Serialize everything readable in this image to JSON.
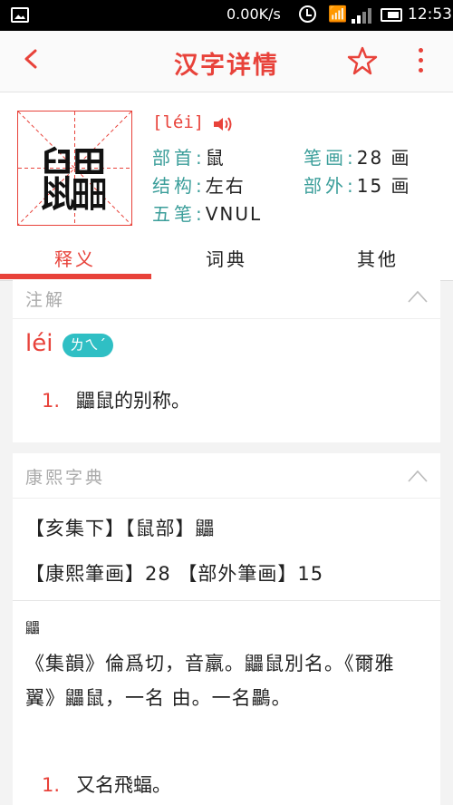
{
  "status_bar": {
    "speed": "0.00K/s",
    "time": "12:53"
  },
  "app_bar": {
    "title": "汉字详情"
  },
  "character": {
    "glyph": "鼺",
    "pinyin_bracket": "[léi]",
    "rows": [
      {
        "key": "部首:",
        "value": "鼠"
      },
      {
        "key": "笔画:",
        "value": "28 画"
      },
      {
        "key": "结构:",
        "value": "左右"
      },
      {
        "key": "部外:",
        "value": "15 画"
      },
      {
        "key": "五笔:",
        "value": "VNUL"
      }
    ]
  },
  "tabs": [
    {
      "label": "释义",
      "active": true
    },
    {
      "label": "词典",
      "active": false
    },
    {
      "label": "其他",
      "active": false
    }
  ],
  "annotation": {
    "title": "注解",
    "pinyin": "léi",
    "zhuyin": "ㄌㄟˊ",
    "definitions": [
      {
        "num": "1.",
        "text": "鼺鼠的别称。"
      }
    ]
  },
  "kangxi": {
    "title": "康熙字典",
    "line1": "【亥集下】【鼠部】鼺",
    "line2": "【康熙筆画】28 【部外筆画】15",
    "small_glyph": "鼺",
    "paragraph": "《集韻》倫爲切，音羸。鼺鼠別名。《爾雅翼》鼺鼠，一名 由。一名鸓。",
    "definitions": [
      {
        "num": "1.",
        "text": "又名飛蝠。"
      }
    ]
  },
  "colors": {
    "accent": "#e8423a",
    "teal": "#3b9e9a",
    "badge": "#2fbfc4"
  }
}
